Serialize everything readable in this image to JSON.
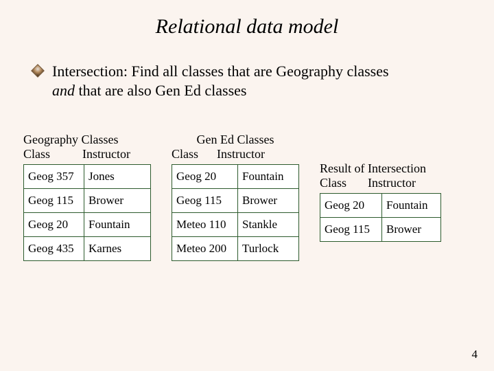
{
  "title": "Relational data model",
  "bullet": {
    "prefix": "Intersection: Find all classes that are Geography classes",
    "and_word": "and",
    "suffix": " that are also Gen Ed classes"
  },
  "geog": {
    "title": "Geography Classes",
    "h1": "Class",
    "h2": "Instructor",
    "rows": [
      {
        "c1": "Geog 357",
        "c2": "Jones"
      },
      {
        "c1": "Geog 115",
        "c2": "Brower"
      },
      {
        "c1": "Geog 20",
        "c2": "Fountain"
      },
      {
        "c1": "Geog 435",
        "c2": "Karnes"
      }
    ]
  },
  "gened": {
    "title": "Gen Ed Classes",
    "h1": "Class",
    "h2": "Instructor",
    "rows": [
      {
        "c1": "Geog 20",
        "c2": "Fountain"
      },
      {
        "c1": "Geog 115",
        "c2": "Brower"
      },
      {
        "c1": "Meteo 110",
        "c2": "Stankle"
      },
      {
        "c1": "Meteo 200",
        "c2": "Turlock"
      }
    ]
  },
  "result": {
    "title": "Result of Intersection",
    "h1": "Class",
    "h2": "Instructor",
    "rows": [
      {
        "c1": "Geog 20",
        "c2": "Fountain"
      },
      {
        "c1": "Geog 115",
        "c2": "Brower"
      }
    ]
  },
  "page_num": "4"
}
